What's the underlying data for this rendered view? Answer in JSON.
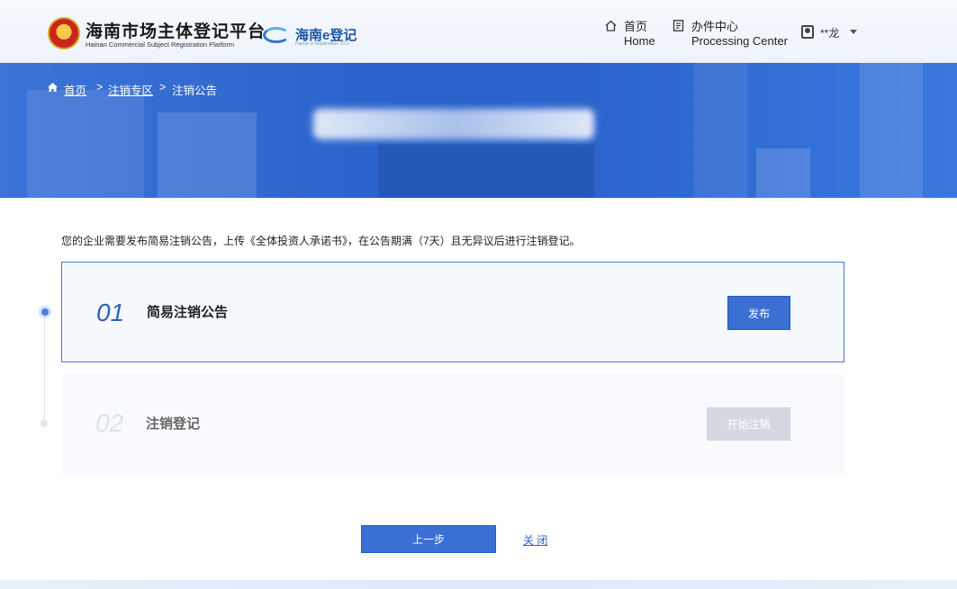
{
  "header": {
    "platform_title": "海南市场主体登记平台",
    "platform_subtitle": "Hainan Commercial Subject Registration Platform",
    "e_logo_text": "海南e登记",
    "e_logo_subtitle": "Hainan e Registration V2.0",
    "nav": {
      "home_label": "首页",
      "home_en": "Home",
      "processing_label": "办件中心",
      "processing_en": "Processing Center"
    },
    "user_name": "**龙"
  },
  "breadcrumb": {
    "items": [
      "首页",
      "注销专区",
      "注销公告"
    ],
    "separator": ">"
  },
  "notice": "您的企业需要发布简易注销公告，上传《全体投资人承诺书》，在公告期满（7天）且无异议后进行注销登记。",
  "steps": [
    {
      "number": "01",
      "title": "简易注销公告",
      "button": "发布",
      "state": "active"
    },
    {
      "number": "02",
      "title": "注销登记",
      "button": "开始注销",
      "state": "disabled"
    }
  ],
  "actions": {
    "prev_label": "上一步",
    "close_label": "关 闭"
  },
  "colors": {
    "primary": "#3a6fd3",
    "banner": "#2a63cc",
    "step_active_border": "#4a7bc8",
    "disabled_button": "#d5d8e0"
  }
}
